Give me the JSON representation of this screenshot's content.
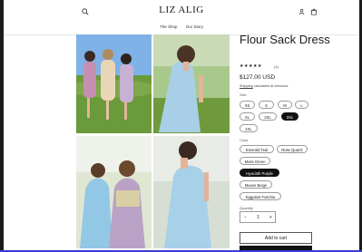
{
  "store": {
    "logo": "LIZ ALIG",
    "nav": [
      "The Shop",
      "Our Story"
    ]
  },
  "product": {
    "title": "Flour Sack Dress",
    "stars": "★★★★★",
    "reviews": "(4)",
    "price": "$127.00 USD",
    "shipping_link": "Shipping",
    "shipping_rest": " calculated at checkout.",
    "size_label": "Size",
    "sizes": [
      {
        "label": "XS",
        "selected": false
      },
      {
        "label": "S",
        "selected": false
      },
      {
        "label": "M",
        "selected": false
      },
      {
        "label": "L",
        "selected": false
      },
      {
        "label": "XL",
        "selected": false
      },
      {
        "label": "2XL",
        "selected": false
      },
      {
        "label": "3XL",
        "selected": true
      },
      {
        "label": "4XL",
        "selected": false
      }
    ],
    "color_label": "Color",
    "colors": [
      {
        "label": "Emerald Teal",
        "selected": false
      },
      {
        "label": "Rose Quartz",
        "selected": false
      },
      {
        "label": "Moss Green",
        "selected": false
      },
      {
        "label": "Hyacinth Purple",
        "selected": true
      },
      {
        "label": "Mauve Beige",
        "selected": false
      },
      {
        "label": "Eggplant Fuschia",
        "selected": false
      }
    ],
    "quantity_label": "Quantity",
    "quantity": "1",
    "minus": "−",
    "plus": "+",
    "add_to_cart": "Add to cart"
  },
  "icons": [
    "search-icon",
    "account-icon",
    "cart-icon"
  ]
}
